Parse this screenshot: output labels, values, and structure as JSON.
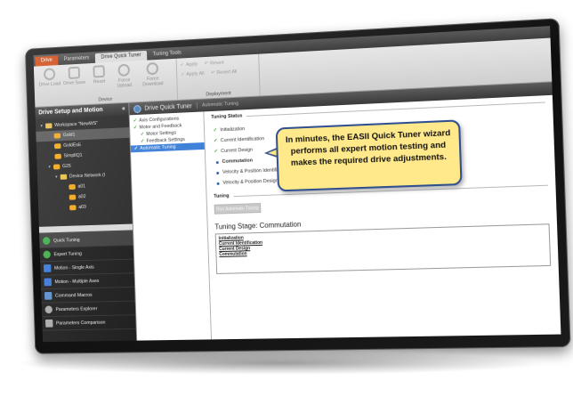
{
  "ribbon": {
    "tabs": [
      {
        "label": "Drive"
      },
      {
        "label": "Parameters"
      },
      {
        "label": "Drive Quick Tuner"
      },
      {
        "label": "Tuning Tools"
      }
    ],
    "device_buttons": [
      {
        "label": "Drive Load",
        "icon": "drive-load-icon"
      },
      {
        "label": "Drive Save",
        "icon": "drive-save-icon"
      },
      {
        "label": "Reset",
        "icon": "reset-icon"
      },
      {
        "label": "Force Upload",
        "icon": "force-upload-icon"
      },
      {
        "label": "Force Download",
        "icon": "force-download-icon"
      }
    ],
    "device_group_label": "Device",
    "deployment": {
      "apply": "Apply",
      "revert": "Revert",
      "apply_all": "Apply All",
      "revert_all": "Revert All",
      "group_label": "Deployment"
    }
  },
  "left": {
    "header": "Drive Setup and Motion",
    "collapse_glyph": "«",
    "tree": [
      {
        "label": "Workspace \"NewWS\"",
        "kind": "folder",
        "arrow": "▾"
      },
      {
        "label": "Gold1",
        "kind": "drive",
        "arrow": ""
      },
      {
        "label": "GoldEsE",
        "kind": "drive",
        "arrow": ""
      },
      {
        "label": "SimplIQ1",
        "kind": "drive",
        "arrow": ""
      },
      {
        "label": "G25",
        "kind": "drive",
        "arrow": "▾"
      },
      {
        "label": "Device Network (I",
        "kind": "folder",
        "arrow": "▾"
      },
      {
        "label": "a01",
        "kind": "drive",
        "arrow": ""
      },
      {
        "label": "a02",
        "kind": "drive",
        "arrow": ""
      },
      {
        "label": "a03",
        "kind": "drive",
        "arrow": ""
      }
    ],
    "nav": [
      {
        "label": "Quick Tuning",
        "color": "#3fae49"
      },
      {
        "label": "Expert Tuning",
        "color": "#3fae49"
      },
      {
        "label": "Motion - Single Axis",
        "color": "#3a78d8"
      },
      {
        "label": "Motion - Multiple Axes",
        "color": "#3a78d8"
      },
      {
        "label": "Command Macros",
        "color": "#5a8fd0"
      },
      {
        "label": "Parameters Explorer",
        "color": "#aaaaaa"
      },
      {
        "label": "Parameters Comparison",
        "color": "#aaaaaa"
      }
    ]
  },
  "content": {
    "title": "Drive Quick Tuner",
    "crumb": "Automatic Tuning",
    "steps": [
      {
        "label": "Axis Configurations",
        "check": "✓"
      },
      {
        "label": "Motor and Feedback",
        "check": "✓"
      },
      {
        "label": "Motor Settings",
        "check": "✓"
      },
      {
        "label": "Feedback Settings",
        "check": "✓"
      },
      {
        "label": "Automatic Tuning",
        "check": "✓"
      }
    ],
    "tuning_status_title": "Tuning Status",
    "statuses": [
      {
        "label": "Initialization",
        "state": "done"
      },
      {
        "label": "Current Identification",
        "state": "done"
      },
      {
        "label": "Current Design",
        "state": "done"
      },
      {
        "label": "Commutation",
        "state": "active"
      },
      {
        "label": "Velocity & Position Identification",
        "state": "pending"
      },
      {
        "label": "Velocity & Position Design",
        "state": "pending"
      }
    ],
    "tuning_title": "Tuning",
    "run_button": "Run Automatic Tuning",
    "stage_title": "Tuning Stage:  Commutation",
    "stage_log": [
      "Initialization",
      "Current Identification",
      "Current Design",
      "Commutation"
    ]
  },
  "callout": {
    "text": "In minutes, the EASII Quick Tuner wizard performs all expert motion testing and makes the required drive adjustments."
  }
}
